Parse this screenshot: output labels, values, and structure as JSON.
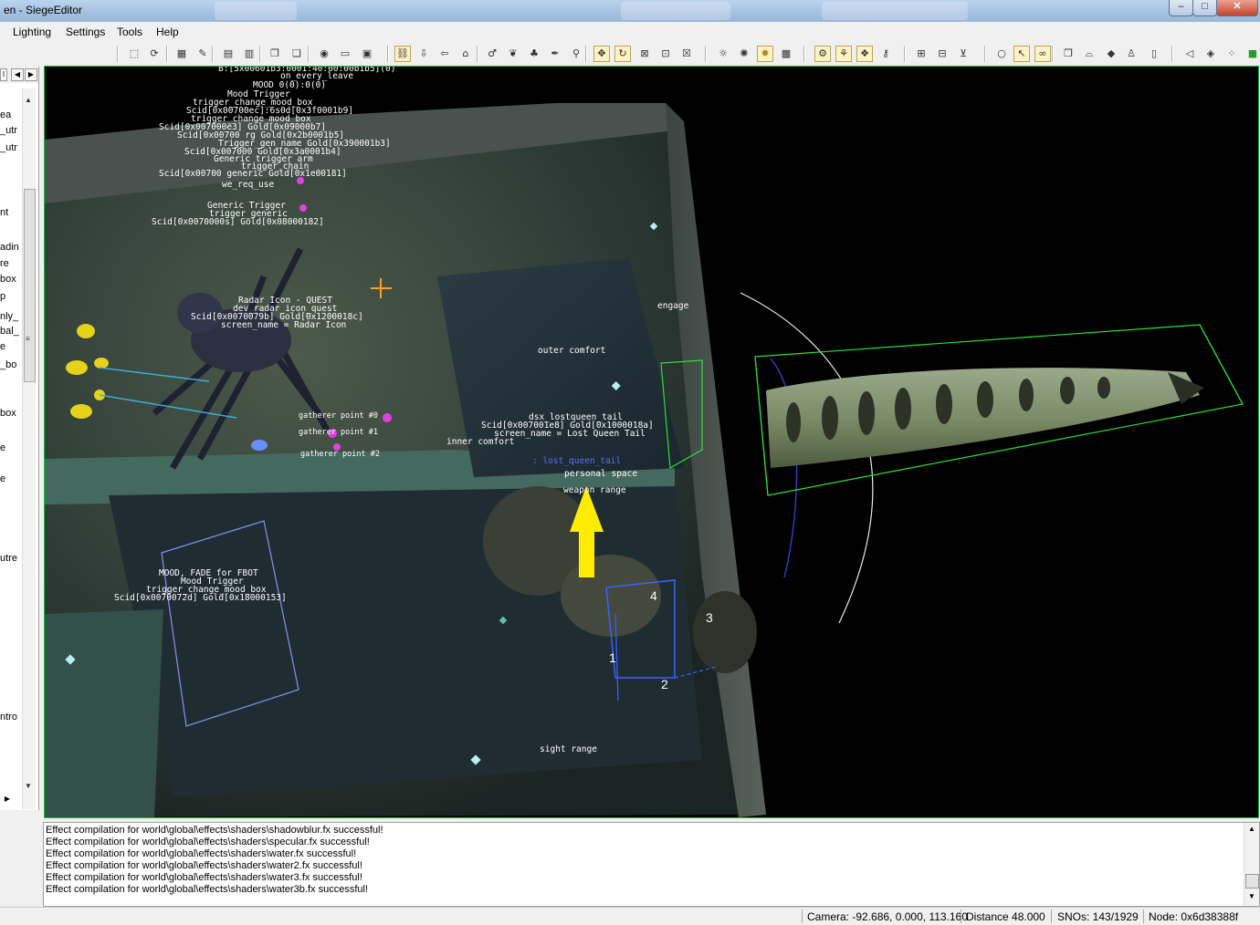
{
  "window": {
    "title": "en - SiegeEditor",
    "buttons": {
      "minimize": "–",
      "maximize": "□",
      "close": "✕"
    }
  },
  "menu": [
    "Lighting",
    "Settings",
    "Tools",
    "Help"
  ],
  "toolbar_icons": [
    "select-icon",
    "rotate-icon",
    "grid-icon",
    "brush-icon",
    "window-icon",
    "panel-icon",
    "copy-icon",
    "paste-icon",
    "node-icon",
    "book-icon",
    "save-icon",
    "link-icon",
    "down-arrow-icon",
    "left-arrow-icon",
    "camera-icon",
    "object-icon",
    "bird-icon",
    "tree-icon",
    "pen-icon",
    "tool-icon",
    "move-icon",
    "rotate-object-icon",
    "lock-icon",
    "lock-open-icon",
    "lock-z-icon",
    "sun-icon",
    "sun-settings-icon",
    "sun-active-icon",
    "lamp-icon",
    "nodes-icon",
    "nodes-brush-icon",
    "nodes-gear-icon",
    "nodes-key-icon",
    "filter-icon",
    "filter-list-icon",
    "filter-down-icon",
    "circle-icon",
    "cursor-icon",
    "loop-icon",
    "layers-icon",
    "stairs-icon",
    "shapes-icon",
    "person-icon",
    "door-icon",
    "left-triangle-icon",
    "diamond-icon",
    "dots-icon",
    "green-block-icon"
  ],
  "left_panel": {
    "items": [
      "ea",
      "_utr",
      "_utr",
      "nt",
      "adin",
      "re",
      "box",
      "p",
      "nly_",
      "bal_",
      "e",
      "_bo",
      "box",
      "e",
      "e",
      "utre",
      "ntro"
    ]
  },
  "viewport": {
    "labels": {
      "header1": "B:[5x00601b3:0001:40:00:00b1b5](0)",
      "header2": "on_every_leave",
      "mood_line": "MOOD    0(0):0(0)",
      "mood_trigger": "Mood Trigger",
      "trigger_change_mood_box": "trigger_change_mood_box",
      "scid1": "Scid[0x00700ec]:6s0d[0x3f0001b9]",
      "trigger_change_mood_box2": "trigger_change_mood_box",
      "scid2": "Scid[0x007000e3] Gold[0x09000b7]",
      "scid3": "Scid[0x00700 rg Gold[0x2b0001b5]",
      "trigger_gen_name": "Trigger_gen_name Gold[0x390001b3]",
      "scid4": "Scid[0x007000 Gold[0x3a0001b4]",
      "generic_trigger_arm": "Generic trigger arm",
      "trigger_chain": "trigger_chain",
      "scid5": "Scid[0x00700 generic Gold[0x1e00181]",
      "we_req_use": "we_req_use",
      "generic_trigger": "Generic Trigger",
      "trigger_generic": "trigger_generic",
      "scid6": "Scid[0x0070000s] Gold[0x08000182]",
      "radar_icon": "Radar Icon - QUEST",
      "dev_radar": "dev_radar_icon_quest",
      "scid7": "Scid[0x0070079b] Gold[0x1200018c]",
      "radar_screen": "screen_name = Radar Icon",
      "engage": "engage",
      "outer_comfort": "outer comfort",
      "inner_comfort": "inner comfort",
      "dsx_tail": "dsx_lostqueen_tail",
      "scid_tail": "Scid[0x007001e8] Gold[0x1000018a]",
      "tail_screen": "screen_name = Lost Queen Tail",
      "lost_queen_tail": ": lost_queen_tail",
      "personal_space": "personal space",
      "weapon_range": "weapon range",
      "gatherer1": "gatherer point #0",
      "gatherer2": "gatherer point #1",
      "gatherer3": "gatherer point #2",
      "mood_fade": "MOOD, FADE for FBOT",
      "mood_trigger2": "Mood Trigger",
      "trigger_change_mood_box3": "trigger_change_mood_box",
      "scid8": "Scid[0x0070072d] Gold[0x18000153]",
      "sight_range": "sight range",
      "num1": "1",
      "num2": "2",
      "num3": "3",
      "num4": "4"
    }
  },
  "log": [
    "Effect compilation for world\\global\\effects\\shaders\\shadowblur.fx successful!",
    "Effect compilation for world\\global\\effects\\shaders\\specular.fx successful!",
    "Effect compilation for world\\global\\effects\\shaders\\water.fx successful!",
    "Effect compilation for world\\global\\effects\\shaders\\water2.fx successful!",
    "Effect compilation for world\\global\\effects\\shaders\\water3.fx successful!",
    "Effect compilation for world\\global\\effects\\shaders\\water3b.fx successful!"
  ],
  "status": {
    "camera": "Camera: -92.686, 0.000, 113.160",
    "distance": "Distance 48.000",
    "snos": "SNOs: 143/1929",
    "node": "Node: 0x6d38388f"
  }
}
